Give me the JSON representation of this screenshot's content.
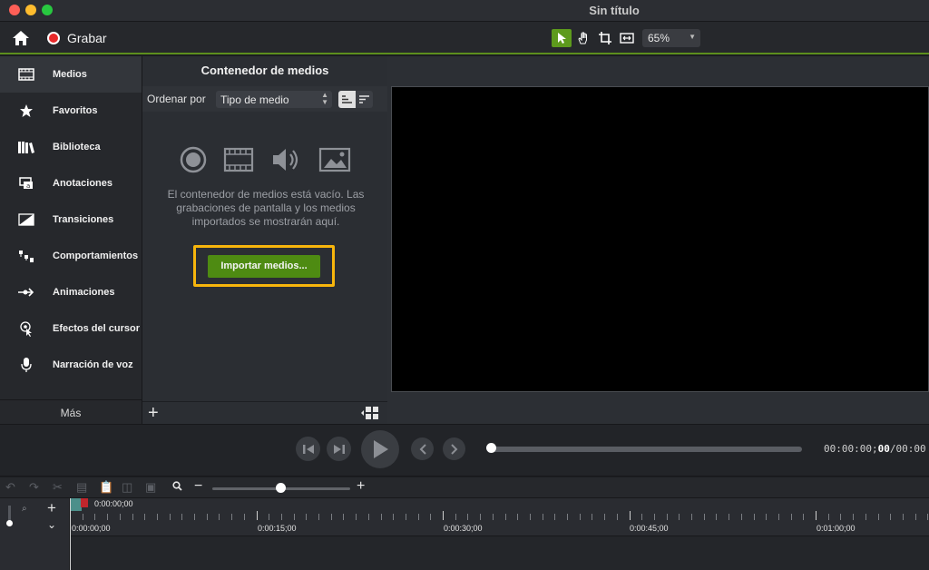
{
  "window": {
    "title": "Sin título"
  },
  "toolbar": {
    "record_label": "Grabar",
    "zoom_value": "65%"
  },
  "sidebar": {
    "items": [
      {
        "label": "Medios",
        "icon": "film-strip-icon",
        "selected": true
      },
      {
        "label": "Favoritos",
        "icon": "star-icon"
      },
      {
        "label": "Biblioteca",
        "icon": "library-books-icon"
      },
      {
        "label": "Anotaciones",
        "icon": "annotation-icon"
      },
      {
        "label": "Transiciones",
        "icon": "transition-icon"
      },
      {
        "label": "Comportamientos",
        "icon": "behaviors-icon"
      },
      {
        "label": "Animaciones",
        "icon": "animation-icon"
      },
      {
        "label": "Efectos del cursor",
        "icon": "cursor-effect-icon"
      },
      {
        "label": "Narración de voz",
        "icon": "microphone-icon"
      }
    ],
    "more_label": "Más"
  },
  "media_bin": {
    "title": "Contenedor de medios",
    "sort_label": "Ordenar por",
    "sort_value": "Tipo de medio",
    "empty_message": "El contenedor de medios está vacío. Las grabaciones de pantalla y los medios importados se mostrarán aquí.",
    "import_button": "Importar medios...",
    "highlight_color": "#f7b50c"
  },
  "playback": {
    "timecode_prefix": "00:00:00;",
    "timecode_frames": "00",
    "timecode_suffix": "/00:00"
  },
  "timeline": {
    "playhead_time": "0:00:00;00",
    "ruler_labels": [
      "0:00:00;00",
      "0:00:15;00",
      "0:00:30;00",
      "0:00:45;00",
      "0:01:00;00"
    ]
  },
  "colors": {
    "accent": "#5d9a1c",
    "record": "#e8292a",
    "import_button": "#4e8b12"
  }
}
